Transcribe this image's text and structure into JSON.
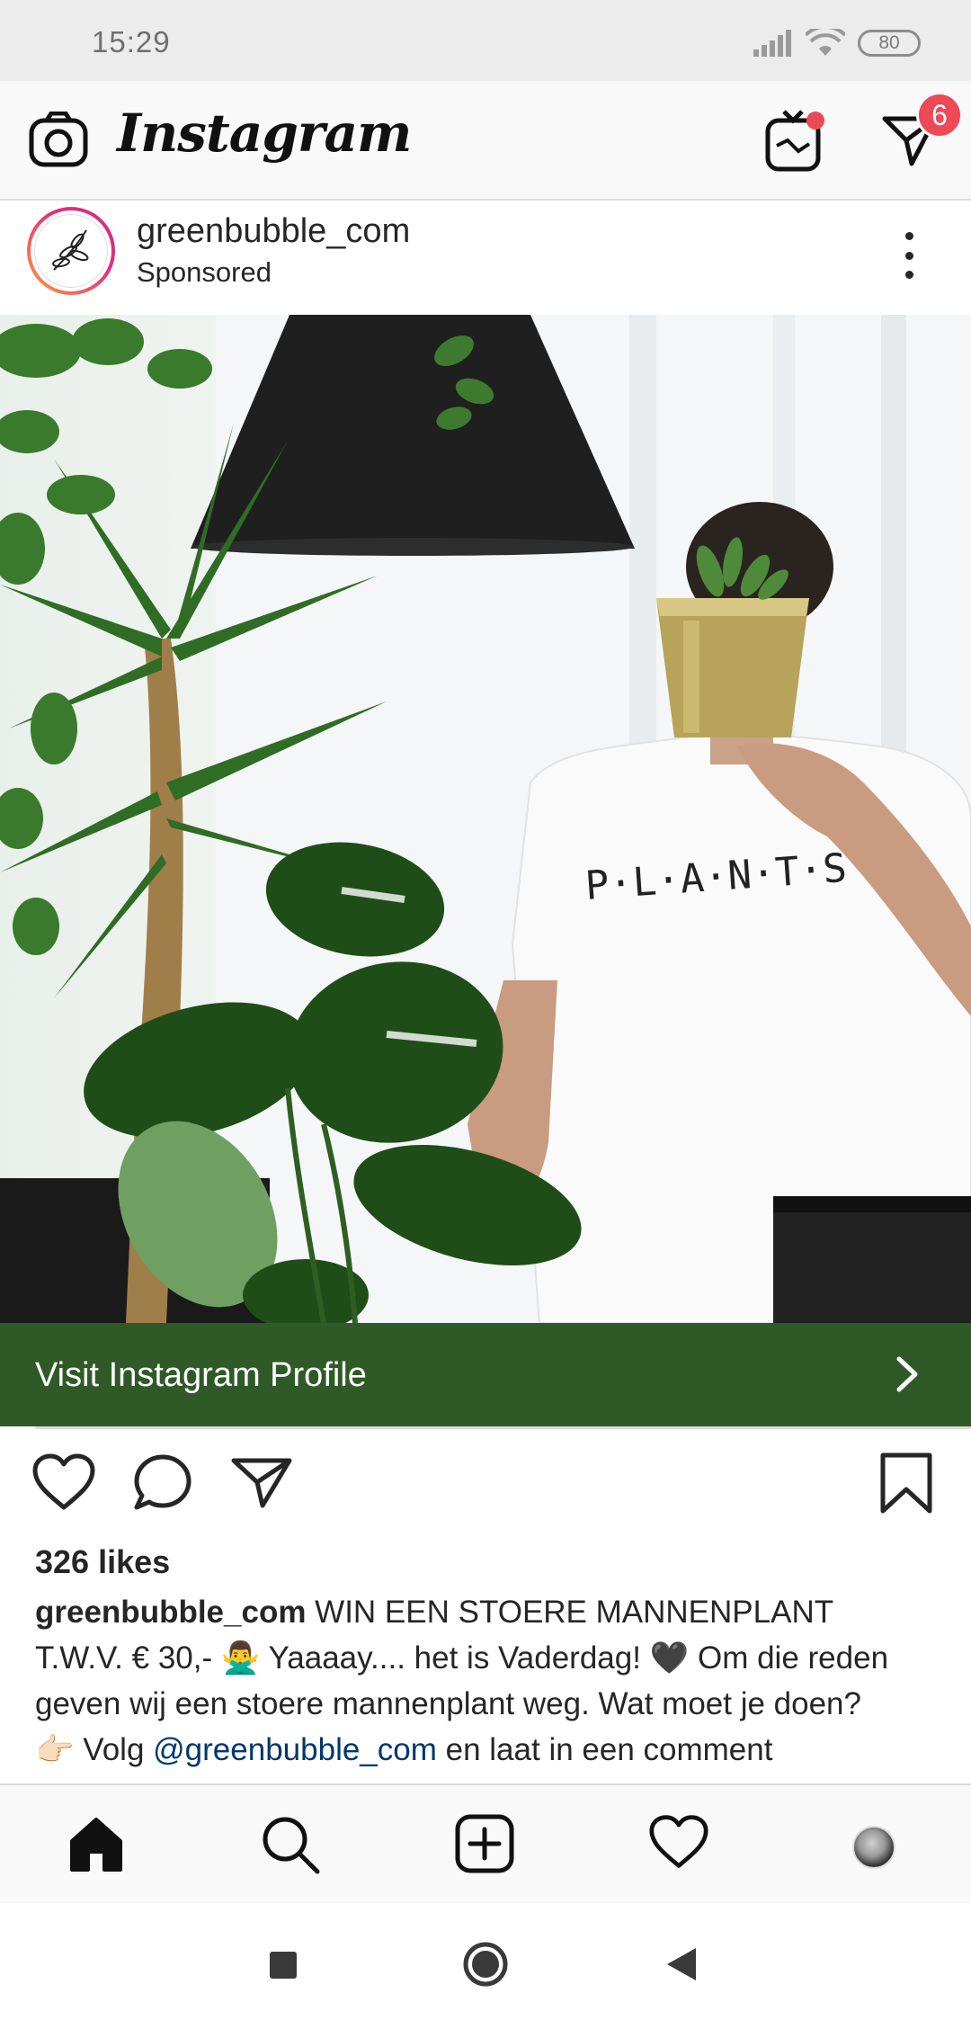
{
  "status_bar": {
    "time": "15:29",
    "battery": "80"
  },
  "header": {
    "logo_text": "Instagram",
    "camera_icon": "camera-icon",
    "igtv_icon": "igtv-icon",
    "direct_icon": "direct-message-icon",
    "direct_badge": "6"
  },
  "post": {
    "username": "greenbubble_com",
    "sponsored_label": "Sponsored",
    "image_shirt_text": "P·L·A·N·T·S",
    "cta_label": "Visit Instagram Profile",
    "likes": "326 likes",
    "caption": {
      "user": "greenbubble_com",
      "line1": " WIN EEN STOERE MANNENPLANT",
      "line2": "T.W.V. € 30,- 🙅‍♂️ Yaaaay.... het is Vaderdag! 🖤 Om die reden",
      "line3": "geven wij een stoere mannenplant weg. Wat moet je doen?",
      "line4_prefix": "👉🏻 Volg ",
      "line4_mention": "@greenbubble_com",
      "line4_suffix": " en laat in een comment"
    }
  },
  "bottom_nav": {
    "items": [
      "home-icon",
      "search-icon",
      "new-post-icon",
      "activity-icon",
      "profile-icon"
    ]
  },
  "system_nav": {
    "items": [
      "recents-button",
      "home-button",
      "back-button"
    ]
  },
  "colors": {
    "cta_background": "#2f5a27",
    "badge": "#ed4956",
    "mention": "#00376b"
  }
}
